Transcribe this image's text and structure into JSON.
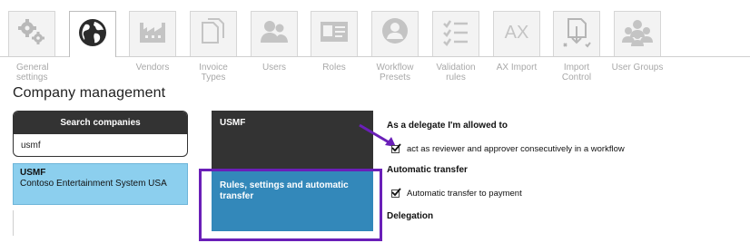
{
  "tabs": [
    {
      "key": "general",
      "label": "General settings",
      "icon": "gears-icon",
      "active": false
    },
    {
      "key": "company",
      "label": "",
      "icon": "globe-icon",
      "active": true
    },
    {
      "key": "vendors",
      "label": "Vendors",
      "icon": "factory-icon",
      "active": false
    },
    {
      "key": "invoice-types",
      "label": "Invoice Types",
      "icon": "documents-icon",
      "active": false
    },
    {
      "key": "users",
      "label": "Users",
      "icon": "users-icon",
      "active": false
    },
    {
      "key": "roles",
      "label": "Roles",
      "icon": "id-card-icon",
      "active": false
    },
    {
      "key": "workflow-presets",
      "label": "Workflow Presets",
      "icon": "user-badge-icon",
      "active": false
    },
    {
      "key": "validation-rules",
      "label": "Validation rules",
      "icon": "checklist-icon",
      "active": false
    },
    {
      "key": "ax-import",
      "label": "AX Import",
      "icon": "ax-icon",
      "active": false
    },
    {
      "key": "import-control",
      "label": "Import Control",
      "icon": "import-control-icon",
      "active": false
    },
    {
      "key": "user-groups",
      "label": "User Groups",
      "icon": "user-groups-icon",
      "active": false
    }
  ],
  "page": {
    "title": "Company management"
  },
  "search": {
    "header": "Search companies",
    "value": "usmf"
  },
  "company": {
    "code": "USMF",
    "name": "Contoso Entertainment System USA"
  },
  "nav": {
    "dark_tile": "USMF",
    "blue_tile": "Rules, settings and automatic transfer"
  },
  "settings": {
    "delegate_title": "As a delegate I'm allowed to",
    "delegate_option": "act as reviewer and approver consecutively in a workflow",
    "transfer_title": "Automatic transfer",
    "transfer_option": "Automatic transfer to payment",
    "delegation_title": "Delegation"
  },
  "colors": {
    "dark": "#333333",
    "selected_company": "#8ccfee",
    "blue_tile": "#3388ba",
    "annotation": "#6a1fb8"
  }
}
